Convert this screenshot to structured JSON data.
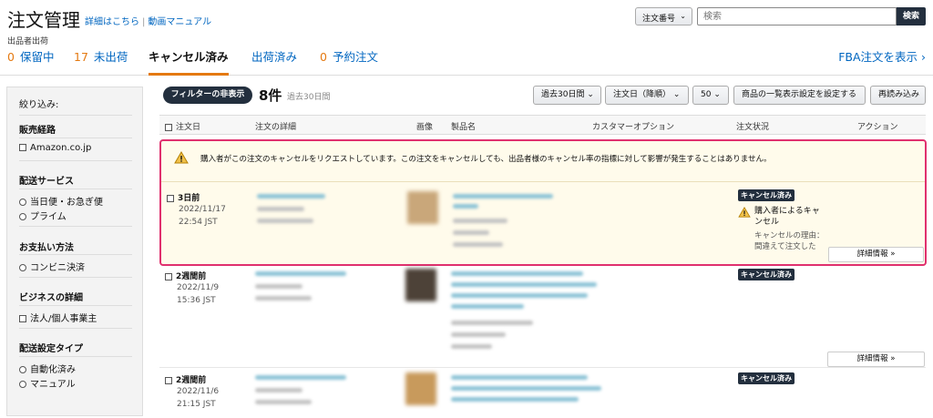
{
  "header": {
    "title": "注文管理",
    "link_details": "詳細はこちら",
    "link_video": "動画マニュアル",
    "seller_fulfilled": "出品者出荷",
    "search_type": "注文番号",
    "search_placeholder": "検索",
    "search_button": "検索"
  },
  "tabs": [
    {
      "count": "0",
      "label": "保留中"
    },
    {
      "count": "17",
      "label": "未出荷"
    },
    {
      "count": "",
      "label": "キャンセル済み"
    },
    {
      "count": "",
      "label": "出荷済み"
    },
    {
      "count": "0",
      "label": "予約注文"
    }
  ],
  "fba_link": "FBA注文を表示",
  "sidebar": {
    "title": "絞り込み:",
    "sections": [
      {
        "heading": "販売経路",
        "options": [
          "Amazon.co.jp"
        ],
        "kind": "checkbox"
      },
      {
        "heading": "配送サービス",
        "options": [
          "当日便・お急ぎ便",
          "プライム"
        ],
        "kind": "radio"
      },
      {
        "heading": "お支払い方法",
        "options": [
          "コンビニ決済"
        ],
        "kind": "radio"
      },
      {
        "heading": "ビジネスの詳細",
        "options": [
          "法人/個人事業主"
        ],
        "kind": "checkbox"
      },
      {
        "heading": "配送設定タイプ",
        "options": [
          "自動化済み",
          "マニュアル"
        ],
        "kind": "radio"
      }
    ]
  },
  "toolbar": {
    "filter_toggle": "フィルターの非表示",
    "count": "8件",
    "period_note": "過去30日間",
    "period_select": "過去30日間",
    "sort_select": "注文日（降順）",
    "page_size": "50",
    "settings_button": "商品の一覧表示設定を設定する",
    "reload_button": "再読み込み"
  },
  "columns": [
    "注文日",
    "注文の詳細",
    "画像",
    "製品名",
    "カスタマーオプション",
    "注文状況",
    "アクション"
  ],
  "alert_text": "購入者がこの注文のキャンセルをリクエストしています。この注文をキャンセルしても、出品者様のキャンセル率の指標に対して影響が発生することはありません。",
  "orders": [
    {
      "relative": "3日前",
      "date": "2022/11/17",
      "time": "22:54 JST",
      "status": "キャンセル済み",
      "reason_title": "購入者によるキャンセル",
      "reason_label": "キャンセルの理由：",
      "reason_value": "間違えて注文した",
      "detail": "詳細情報"
    },
    {
      "relative": "2週間前",
      "date": "2022/11/9",
      "time": "15:36 JST",
      "status": "キャンセル済み",
      "detail": "詳細情報"
    },
    {
      "relative": "2週間前",
      "date": "2022/11/6",
      "time": "21:15 JST",
      "status": "キャンセル済み"
    }
  ],
  "colors": {
    "accent_orange": "#e47911",
    "link_blue": "#0066c0",
    "dark": "#232f3e",
    "highlight_border": "#e0306e",
    "highlight_bg": "#fffbeb"
  }
}
